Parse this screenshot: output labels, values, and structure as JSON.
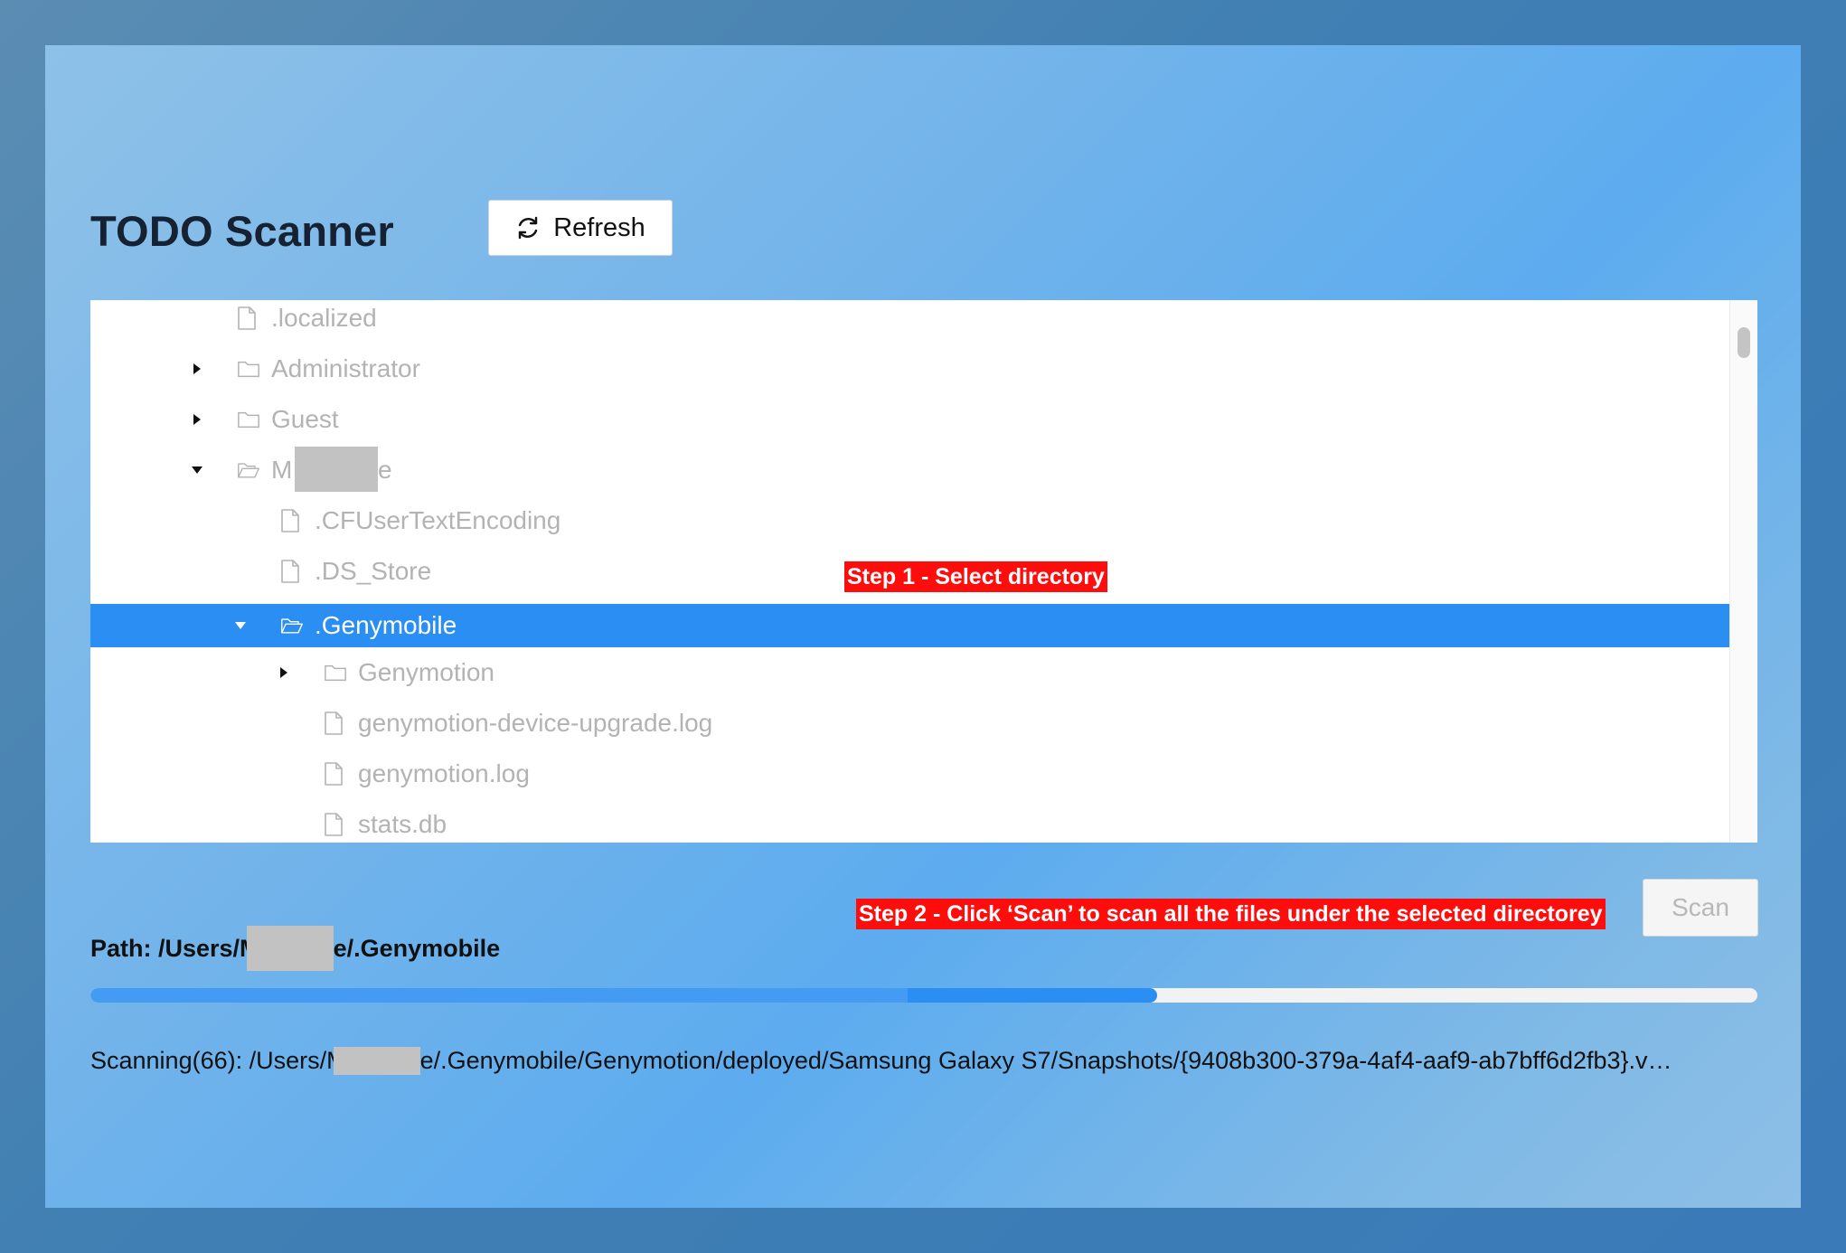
{
  "header": {
    "title": "TODO Scanner",
    "refresh_label": "Refresh"
  },
  "tree": {
    "rows": [
      {
        "label": ".localized",
        "type": "file",
        "expanded": null,
        "selected": false
      },
      {
        "label": "Administrator",
        "type": "folder",
        "expanded": false,
        "selected": false
      },
      {
        "label": "Guest",
        "type": "folder",
        "expanded": false,
        "selected": false
      },
      {
        "label": "M",
        "label_suffix": "e",
        "type": "folder",
        "expanded": true,
        "selected": false,
        "redacted": true
      },
      {
        "label": ".CFUserTextEncoding",
        "type": "file",
        "expanded": null,
        "selected": false
      },
      {
        "label": ".DS_Store",
        "type": "file",
        "expanded": null,
        "selected": false
      },
      {
        "label": ".Genymobile",
        "type": "folder",
        "expanded": true,
        "selected": true
      },
      {
        "label": "Genymotion",
        "type": "folder",
        "expanded": false,
        "selected": false
      },
      {
        "label": "genymotion-device-upgrade.log",
        "type": "file",
        "expanded": null,
        "selected": false
      },
      {
        "label": "genymotion.log",
        "type": "file",
        "expanded": null,
        "selected": false
      },
      {
        "label": "stats.db",
        "type": "file",
        "expanded": null,
        "selected": false
      }
    ]
  },
  "annotations": {
    "step1": "Step 1 - Select directory",
    "step2": "Step 2 - Click ‘Scan’ to scan all the files under the selected directorey"
  },
  "path": {
    "prefix": "Path: /Users/M",
    "suffix": "e/.Genymobile"
  },
  "scan_label": "Scan",
  "progress": {
    "fraction": 0.64,
    "secondary_fraction": 0.49
  },
  "scanning": {
    "prefix": "Scanning(66): /Users/M",
    "suffix": "e/.Genymobile/Genymotion/deployed/Samsung Galaxy S7/Snapshots/{9408b300-379a-4af4-aaf9-ab7bff6d2fb3}.v…"
  },
  "colors": {
    "accent": "#2a8ef2",
    "annotation": "#ff0d0d",
    "tree_text": "#b3b3b3"
  }
}
